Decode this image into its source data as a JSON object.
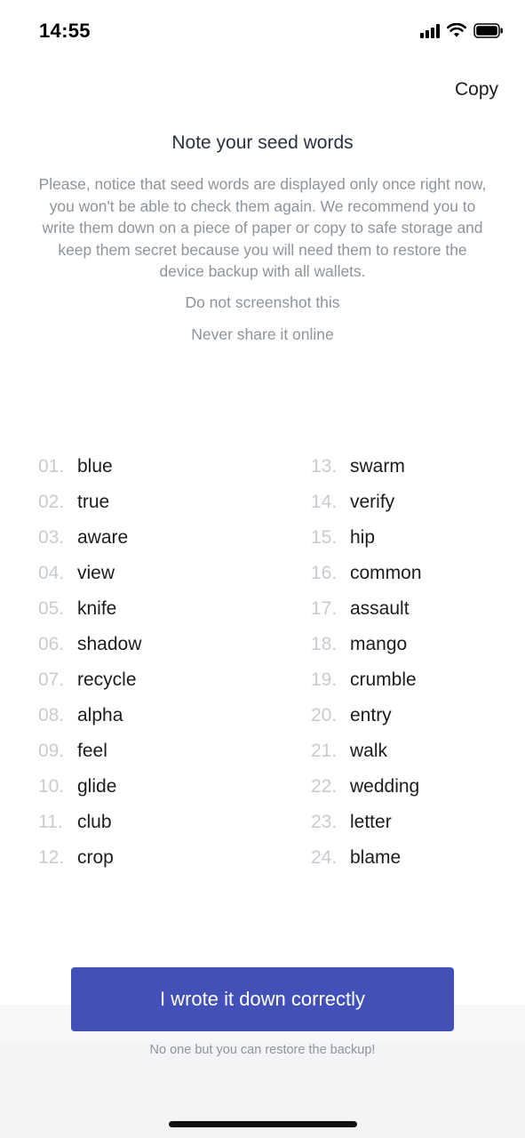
{
  "status_bar": {
    "time": "14:55",
    "icons": [
      "signal-icon",
      "wifi-icon",
      "battery-icon"
    ]
  },
  "header": {
    "copy_label": "Copy"
  },
  "title": "Note your seed words",
  "description": "Please, notice that seed words are displayed only once right now, you won't be able to check them again. We recommend you to write them down on a piece of paper or copy to safe storage and keep them secret because you will need them to restore the device backup with all wallets.",
  "warnings": [
    "Do not screenshot this",
    "Never share it online"
  ],
  "seed_words": {
    "left": [
      {
        "num": "01.",
        "word": "blue"
      },
      {
        "num": "02.",
        "word": "true"
      },
      {
        "num": "03.",
        "word": "aware"
      },
      {
        "num": "04.",
        "word": "view"
      },
      {
        "num": "05.",
        "word": "knife"
      },
      {
        "num": "06.",
        "word": "shadow"
      },
      {
        "num": "07.",
        "word": "recycle"
      },
      {
        "num": "08.",
        "word": "alpha"
      },
      {
        "num": "09.",
        "word": "feel"
      },
      {
        "num": "10.",
        "word": "glide"
      },
      {
        "num": "11.",
        "word": "club"
      },
      {
        "num": "12.",
        "word": "crop"
      }
    ],
    "right": [
      {
        "num": "13.",
        "word": "swarm"
      },
      {
        "num": "14.",
        "word": "verify"
      },
      {
        "num": "15.",
        "word": "hip"
      },
      {
        "num": "16.",
        "word": "common"
      },
      {
        "num": "17.",
        "word": "assault"
      },
      {
        "num": "18.",
        "word": "mango"
      },
      {
        "num": "19.",
        "word": "crumble"
      },
      {
        "num": "20.",
        "word": "entry"
      },
      {
        "num": "21.",
        "word": "walk"
      },
      {
        "num": "22.",
        "word": "wedding"
      },
      {
        "num": "23.",
        "word": "letter"
      },
      {
        "num": "24.",
        "word": "blame"
      }
    ]
  },
  "confirm_button_label": "I wrote it down correctly",
  "footnote": "No one but you can restore the backup!",
  "colors": {
    "primary_button": "#4250b8",
    "muted_text": "#8e949c",
    "number_text": "#c8ccd2"
  }
}
